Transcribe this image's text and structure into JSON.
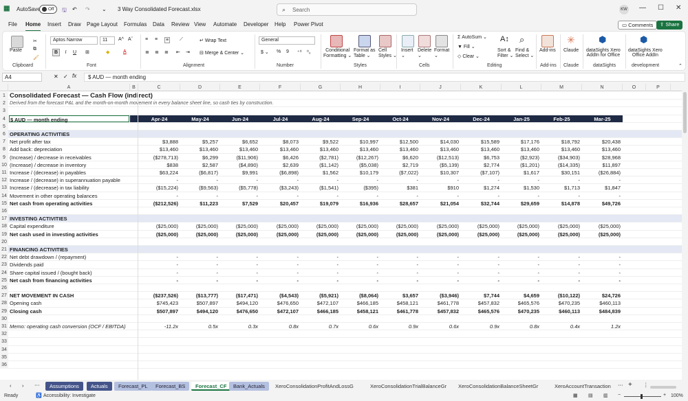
{
  "titlebar": {
    "autosave_label": "AutoSave",
    "autosave_state": "Off",
    "filename": "3 Way Consolidated Forecast.xlsx",
    "search_placeholder": "Search",
    "avatar": "KW"
  },
  "menu": [
    "File",
    "Home",
    "Insert",
    "Draw",
    "Page Layout",
    "Formulas",
    "Data",
    "Review",
    "View",
    "Automate",
    "Developer",
    "Help",
    "Power Pivot"
  ],
  "comments_label": "Comments",
  "share_label": "Share",
  "ribbon": {
    "paste": "Paste",
    "clipboard": "Clipboard",
    "font_name": "Aptos Narrow",
    "font_size": "11",
    "font_group": "Font",
    "wrap_text": "Wrap Text",
    "merge_center": "Merge & Center",
    "alignment": "Alignment",
    "number_format": "General",
    "number_group": "Number",
    "cond_format": "Conditional",
    "cond_format2": "Formatting",
    "format_table": "Format as",
    "format_table2": "Table",
    "cell_styles": "Cell",
    "cell_styles2": "Styles",
    "styles_group": "Styles",
    "insert": "Insert",
    "delete": "Delete",
    "format": "Format",
    "cells_group": "Cells",
    "autosum": "AutoSum",
    "fill": "Fill",
    "clear": "Clear",
    "sort_filter": "Sort &",
    "sort_filter2": "Filter",
    "find_select": "Find &",
    "find_select2": "Select",
    "editing_group": "Editing",
    "addins": "Add-ins",
    "addins_group": "Add-ins",
    "claude": "Claude",
    "claude_group": "Claude",
    "ds1": "dataSights Xero",
    "ds1b": "AddIn for Office",
    "ds_group": "dataSights",
    "ds2": "dataSights Xero",
    "ds2b": "Office AddIn",
    "dev_group": "development"
  },
  "formula_bar": {
    "name_box": "A4",
    "fx": "fx",
    "content": "$ AUD — month ending"
  },
  "columns": [
    "A",
    "B",
    "C",
    "D",
    "E",
    "F",
    "G",
    "H",
    "I",
    "J",
    "K",
    "L",
    "M",
    "N",
    "O",
    "P"
  ],
  "sheet": {
    "title": "Consolidated Forecast — Cash Flow (indirect)",
    "subtitle": "Derived from the forecast P&L and the month-on-month movement in every balance sheet line, so cash ties by construction.",
    "header_label": "$ AUD — month ending",
    "months": [
      "Apr-24",
      "May-24",
      "Jun-24",
      "Jul-24",
      "Aug-24",
      "Sep-24",
      "Oct-24",
      "Nov-24",
      "Dec-24",
      "Jan-25",
      "Feb-25",
      "Mar-25"
    ],
    "rows": [
      {
        "n": "6",
        "label": "OPERATING ACTIVITIES",
        "style": "section",
        "vals": []
      },
      {
        "n": "7",
        "label": "Net profit after tax",
        "style": "",
        "vals": [
          "$3,888",
          "$5,257",
          "$6,652",
          "$8,073",
          "$9,522",
          "$10,997",
          "$12,500",
          "$14,030",
          "$15,589",
          "$17,176",
          "$18,792",
          "$20,438"
        ]
      },
      {
        "n": "8",
        "label": "Add back: depreciation",
        "style": "",
        "vals": [
          "$13,460",
          "$13,460",
          "$13,460",
          "$13,460",
          "$13,460",
          "$13,460",
          "$13,460",
          "$13,460",
          "$13,460",
          "$13,460",
          "$13,460",
          "$13,460"
        ]
      },
      {
        "n": "9",
        "label": "(Increase) / decrease in receivables",
        "style": "",
        "vals": [
          "($278,713)",
          "$6,299",
          "($11,906)",
          "$6,426",
          "($2,781)",
          "($12,267)",
          "$6,620",
          "($12,513)",
          "$6,753",
          "($2,923)",
          "($34,903)",
          "$28,968"
        ]
      },
      {
        "n": "10",
        "label": "(Increase) / decrease in inventory",
        "style": "",
        "vals": [
          "$838",
          "$2,587",
          "($4,890)",
          "$2,639",
          "($1,142)",
          "($5,038)",
          "$2,719",
          "($5,139)",
          "$2,774",
          "($1,201)",
          "($14,335)",
          "$11,897"
        ]
      },
      {
        "n": "11",
        "label": "Increase / (decrease) in payables",
        "style": "",
        "vals": [
          "$63,224",
          "($6,817)",
          "$9,991",
          "($6,898)",
          "$1,562",
          "$10,179",
          "($7,022)",
          "$10,307",
          "($7,107)",
          "$1,617",
          "$30,151",
          "($26,884)"
        ]
      },
      {
        "n": "12",
        "label": "Increase / (decrease) in superannuation payable",
        "style": "",
        "vals": [
          "-",
          "-",
          "-",
          "-",
          "-",
          "-",
          "-",
          "-",
          "-",
          "-",
          "-",
          "-"
        ]
      },
      {
        "n": "13",
        "label": "Increase / (decrease) in tax liability",
        "style": "",
        "vals": [
          "($15,224)",
          "($9,563)",
          "($5,778)",
          "($3,243)",
          "($1,541)",
          "($395)",
          "$381",
          "$910",
          "$1,274",
          "$1,530",
          "$1,713",
          "$1,847"
        ]
      },
      {
        "n": "14",
        "label": "Movement in other operating balances",
        "style": "",
        "vals": [
          "-",
          "-",
          "-",
          "-",
          "-",
          "-",
          "-",
          "-",
          "-",
          "-",
          "-",
          "-"
        ]
      },
      {
        "n": "15",
        "label": "Net cash from operating activities",
        "style": "bold",
        "vals": [
          "($212,526)",
          "$11,223",
          "$7,529",
          "$20,457",
          "$19,079",
          "$16,936",
          "$28,657",
          "$21,054",
          "$32,744",
          "$29,659",
          "$14,878",
          "$49,726"
        ]
      },
      {
        "n": "16",
        "label": "",
        "style": "",
        "vals": []
      },
      {
        "n": "17",
        "label": "INVESTING ACTIVITIES",
        "style": "section",
        "vals": []
      },
      {
        "n": "18",
        "label": "Capital expenditure",
        "style": "",
        "vals": [
          "($25,000)",
          "($25,000)",
          "($25,000)",
          "($25,000)",
          "($25,000)",
          "($25,000)",
          "($25,000)",
          "($25,000)",
          "($25,000)",
          "($25,000)",
          "($25,000)",
          "($25,000)"
        ]
      },
      {
        "n": "19",
        "label": "Net cash used in investing activities",
        "style": "bold",
        "vals": [
          "($25,000)",
          "($25,000)",
          "($25,000)",
          "($25,000)",
          "($25,000)",
          "($25,000)",
          "($25,000)",
          "($25,000)",
          "($25,000)",
          "($25,000)",
          "($25,000)",
          "($25,000)"
        ]
      },
      {
        "n": "20",
        "label": "",
        "style": "",
        "vals": []
      },
      {
        "n": "21",
        "label": "FINANCING ACTIVITIES",
        "style": "section",
        "vals": []
      },
      {
        "n": "22",
        "label": "Net debt drawdown / (repayment)",
        "style": "",
        "vals": [
          "-",
          "-",
          "-",
          "-",
          "-",
          "-",
          "-",
          "-",
          "-",
          "-",
          "-",
          "-"
        ]
      },
      {
        "n": "23",
        "label": "Dividends paid",
        "style": "",
        "vals": [
          "-",
          "-",
          "-",
          "-",
          "-",
          "-",
          "-",
          "-",
          "-",
          "-",
          "-",
          "-"
        ]
      },
      {
        "n": "24",
        "label": "Share capital issued / (bought back)",
        "style": "",
        "vals": [
          "-",
          "-",
          "-",
          "-",
          "-",
          "-",
          "-",
          "-",
          "-",
          "-",
          "-",
          "-"
        ]
      },
      {
        "n": "25",
        "label": "Net cash from financing activities",
        "style": "bold",
        "vals": [
          "-",
          "-",
          "-",
          "-",
          "-",
          "-",
          "-",
          "-",
          "-",
          "-",
          "-",
          "-"
        ]
      },
      {
        "n": "26",
        "label": "",
        "style": "",
        "vals": []
      },
      {
        "n": "27",
        "label": "NET MOVEMENT IN CASH",
        "style": "bold",
        "vals": [
          "($237,526)",
          "($13,777)",
          "($17,471)",
          "($4,543)",
          "($5,921)",
          "($8,064)",
          "$3,657",
          "($3,946)",
          "$7,744",
          "$4,659",
          "($10,122)",
          "$24,726"
        ]
      },
      {
        "n": "28",
        "label": "Opening cash",
        "style": "",
        "vals": [
          "$745,423",
          "$507,897",
          "$494,120",
          "$476,650",
          "$472,107",
          "$466,185",
          "$458,121",
          "$461,778",
          "$457,832",
          "$465,576",
          "$470,235",
          "$460,113"
        ]
      },
      {
        "n": "29",
        "label": "Closing cash",
        "style": "bold",
        "vals": [
          "$507,897",
          "$494,120",
          "$476,650",
          "$472,107",
          "$466,185",
          "$458,121",
          "$461,778",
          "$457,832",
          "$465,576",
          "$470,235",
          "$460,113",
          "$484,839"
        ]
      },
      {
        "n": "30",
        "label": "",
        "style": "",
        "vals": []
      },
      {
        "n": "31",
        "label": "Memo: operating cash conversion (OCF / EBITDA)",
        "style": "ital",
        "vals": [
          "-11.2x",
          "0.5x",
          "0.3x",
          "0.8x",
          "0.7x",
          "0.6x",
          "0.9x",
          "0.6x",
          "0.9x",
          "0.8x",
          "0.4x",
          "1.2x"
        ]
      },
      {
        "n": "32",
        "label": "",
        "style": "",
        "vals": []
      },
      {
        "n": "33",
        "label": "",
        "style": "",
        "vals": []
      },
      {
        "n": "34",
        "label": "",
        "style": "",
        "vals": []
      },
      {
        "n": "35",
        "label": "",
        "style": "",
        "vals": []
      },
      {
        "n": "36",
        "label": "",
        "style": "",
        "vals": []
      }
    ]
  },
  "tabs": [
    {
      "name": "Assumptions",
      "style": "navy"
    },
    {
      "name": "Actuals",
      "style": "navy"
    },
    {
      "name": "Forecast_PL",
      "style": "light"
    },
    {
      "name": "Forecast_BS",
      "style": "light"
    },
    {
      "name": "Forecast_CF",
      "style": "active"
    },
    {
      "name": "Bank_Actuals",
      "style": "light"
    },
    {
      "name": "XeroConsolidationProfitAndLossG",
      "style": "plain"
    },
    {
      "name": "XeroConsolidationTrialBalanceGr",
      "style": "plain"
    },
    {
      "name": "XeroConsolidationBalanceSheetGr",
      "style": "plain"
    },
    {
      "name": "XeroAccountTransaction",
      "style": "plain"
    }
  ],
  "status": {
    "ready": "Ready",
    "accessibility": "Accessibility: Investigate",
    "zoom": "100%"
  }
}
